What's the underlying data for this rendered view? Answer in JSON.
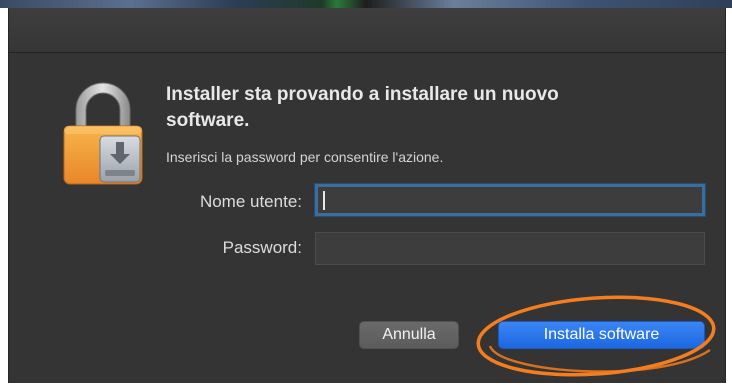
{
  "dialog": {
    "headline": "Installer sta provando a installare un nuovo software.",
    "subtext": "Inserisci la password per consentire l'azione."
  },
  "form": {
    "username_label": "Nome utente:",
    "username_value": "",
    "password_label": "Password:",
    "password_value": ""
  },
  "buttons": {
    "cancel_label": "Annulla",
    "install_label": "Installa software"
  },
  "icons": {
    "dialog_icon": "lock-installer-icon"
  },
  "colors": {
    "window_background": "#343434",
    "primary_button": "#2a74ea",
    "focus_ring": "#3a6e9c",
    "annotation": "#f47d20",
    "lock_body": "#f4a23a"
  }
}
